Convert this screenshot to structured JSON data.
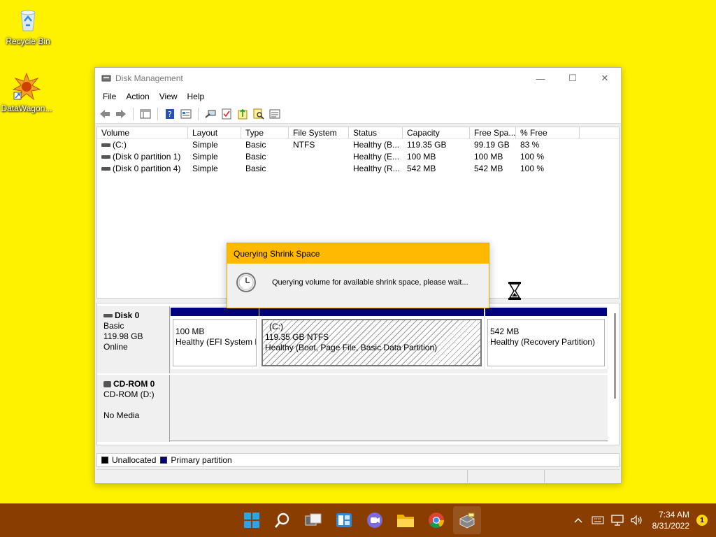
{
  "desktop": {
    "icons": [
      {
        "label": "Recycle Bin"
      },
      {
        "label": "DataWagon..."
      }
    ]
  },
  "window": {
    "title": "Disk Management",
    "controls": {
      "minimize": "—",
      "maximize": "☐",
      "close": "✕"
    },
    "menus": [
      "File",
      "Action",
      "View",
      "Help"
    ]
  },
  "volume_table": {
    "headers": [
      "Volume",
      "Layout",
      "Type",
      "File System",
      "Status",
      "Capacity",
      "Free Spa...",
      "% Free"
    ],
    "rows": [
      [
        "(C:)",
        "Simple",
        "Basic",
        "NTFS",
        "Healthy (B...",
        "119.35 GB",
        "99.19 GB",
        "83 %"
      ],
      [
        "(Disk 0 partition 1)",
        "Simple",
        "Basic",
        "",
        "Healthy (E...",
        "100 MB",
        "100 MB",
        "100 %"
      ],
      [
        "(Disk 0 partition 4)",
        "Simple",
        "Basic",
        "",
        "Healthy (R...",
        "542 MB",
        "542 MB",
        "100 %"
      ]
    ]
  },
  "disks": [
    {
      "name": "Disk 0",
      "type": "Basic",
      "size": "119.98 GB",
      "status": "Online"
    },
    {
      "name": "CD-ROM 0",
      "type": "CD-ROM (D:)",
      "size": "",
      "status": "No Media"
    }
  ],
  "partitions": [
    {
      "title": "",
      "line1": "100 MB",
      "line2": "Healthy (EFI System P"
    },
    {
      "title": "(C:)",
      "line1": "119.35 GB NTFS",
      "line2": "Healthy (Boot, Page File, Basic Data Partition)"
    },
    {
      "title": "",
      "line1": "542 MB",
      "line2": "Healthy (Recovery Partition)"
    }
  ],
  "legend": [
    {
      "label": "Unallocated",
      "color": "#000000"
    },
    {
      "label": "Primary partition",
      "color": "#000080"
    }
  ],
  "dialog": {
    "title": "Querying Shrink Space",
    "message": "Querying volume for available shrink space, please wait..."
  },
  "taskbar": {
    "apps": [
      "start-icon",
      "search-icon",
      "task-view-icon",
      "widgets-icon",
      "chat-icon",
      "file-explorer-icon",
      "chrome-icon",
      "disk-management-icon"
    ],
    "time": "7:34 AM",
    "date": "8/31/2022",
    "notification_count": "1"
  },
  "colors": {
    "desktop": "#fff200",
    "taskbar": "#8a3d00",
    "primary_partition": "#000080",
    "dialog_title": "#ffb900"
  }
}
